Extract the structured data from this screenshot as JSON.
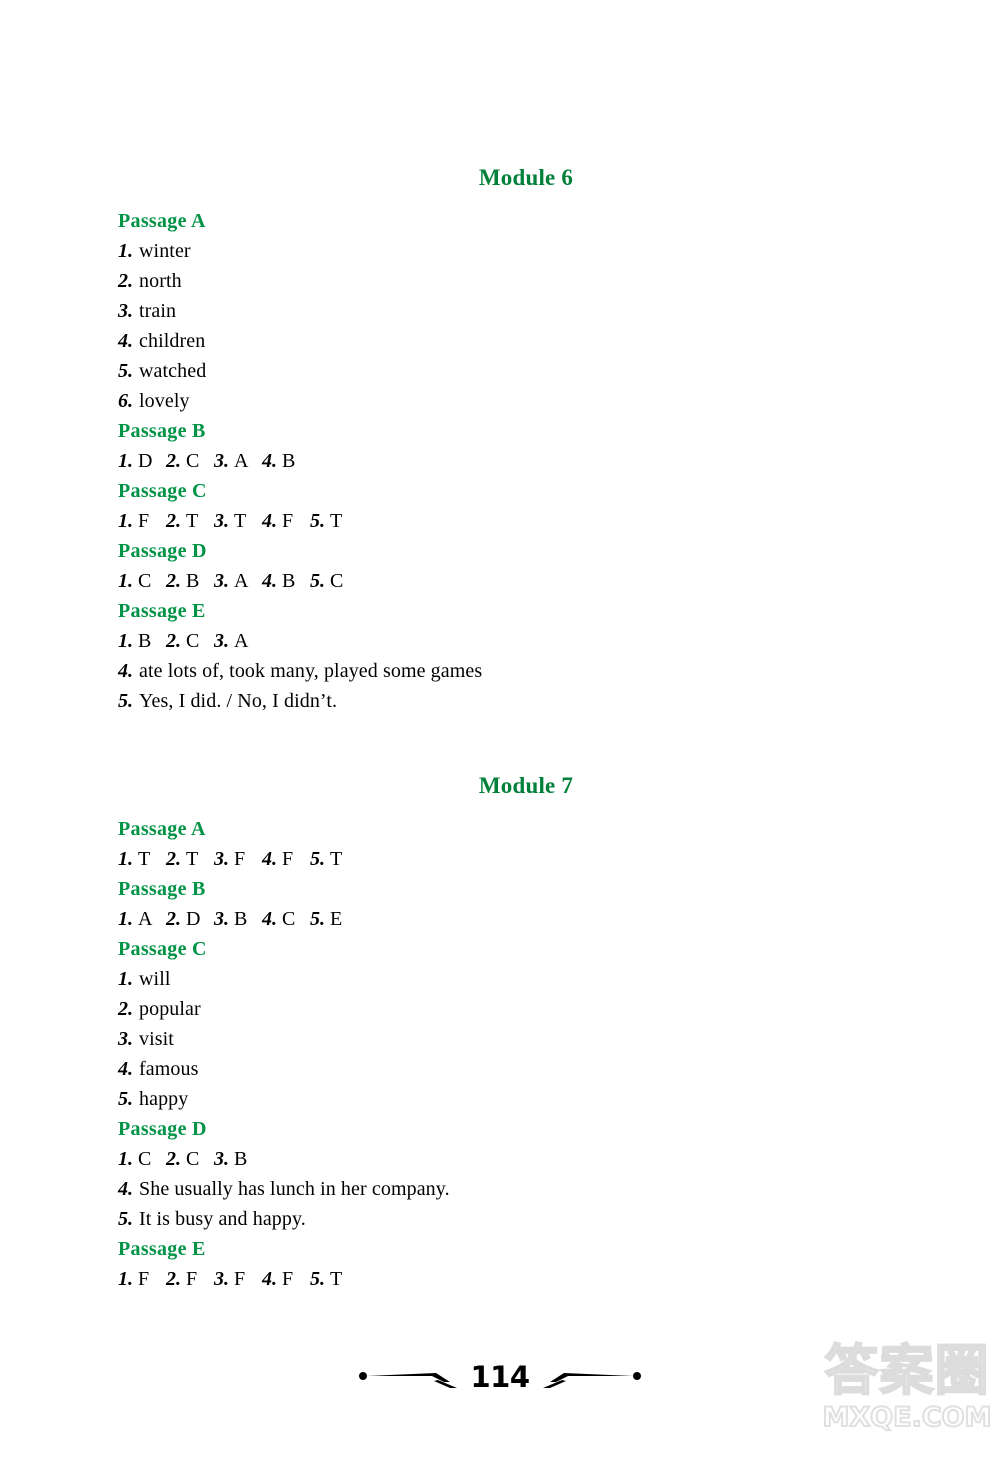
{
  "page": {
    "folio": "114",
    "watermark_cn": "答案圈",
    "watermark_url": "MXQE.COM",
    "accent_green": "#009245",
    "title_green": "#008038",
    "text_black": "#000000",
    "background": "#ffffff"
  },
  "modules": [
    {
      "title": "Module 6",
      "passages": [
        {
          "label": "Passage A",
          "layout": "stacked",
          "items": [
            {
              "num": "1.",
              "value": "winter"
            },
            {
              "num": "2.",
              "value": "north"
            },
            {
              "num": "3.",
              "value": "train"
            },
            {
              "num": "4.",
              "value": "children"
            },
            {
              "num": "5.",
              "value": "watched"
            },
            {
              "num": "6.",
              "value": "lovely"
            }
          ]
        },
        {
          "label": "Passage B",
          "layout": "inline",
          "items": [
            {
              "num": "1.",
              "value": "D"
            },
            {
              "num": "2.",
              "value": "C"
            },
            {
              "num": "3.",
              "value": "A"
            },
            {
              "num": "4.",
              "value": "B"
            }
          ]
        },
        {
          "label": "Passage C",
          "layout": "inline",
          "items": [
            {
              "num": "1.",
              "value": "F"
            },
            {
              "num": "2.",
              "value": "T"
            },
            {
              "num": "3.",
              "value": "T"
            },
            {
              "num": "4.",
              "value": "F"
            },
            {
              "num": "5.",
              "value": "T"
            }
          ]
        },
        {
          "label": "Passage D",
          "layout": "inline",
          "items": [
            {
              "num": "1.",
              "value": "C"
            },
            {
              "num": "2.",
              "value": "B"
            },
            {
              "num": "3.",
              "value": "A"
            },
            {
              "num": "4.",
              "value": "B"
            },
            {
              "num": "5.",
              "value": "C"
            }
          ]
        },
        {
          "label": "Passage E",
          "layout": "mixed",
          "inline_items": [
            {
              "num": "1.",
              "value": "B"
            },
            {
              "num": "2.",
              "value": "C"
            },
            {
              "num": "3.",
              "value": "A"
            }
          ],
          "items": [
            {
              "num": "4.",
              "value": "ate lots of, took many, played some games"
            },
            {
              "num": "5.",
              "value": "Yes, I did. / No, I didn’t."
            }
          ]
        }
      ]
    },
    {
      "title": "Module 7",
      "passages": [
        {
          "label": "Passage A",
          "layout": "inline",
          "items": [
            {
              "num": "1.",
              "value": "T"
            },
            {
              "num": "2.",
              "value": "T"
            },
            {
              "num": "3.",
              "value": "F"
            },
            {
              "num": "4.",
              "value": "F"
            },
            {
              "num": "5.",
              "value": "T"
            }
          ]
        },
        {
          "label": "Passage B",
          "layout": "inline",
          "items": [
            {
              "num": "1.",
              "value": "A"
            },
            {
              "num": "2.",
              "value": "D"
            },
            {
              "num": "3.",
              "value": "B"
            },
            {
              "num": "4.",
              "value": "C"
            },
            {
              "num": "5.",
              "value": "E"
            }
          ]
        },
        {
          "label": "Passage C",
          "layout": "stacked",
          "items": [
            {
              "num": "1.",
              "value": "will"
            },
            {
              "num": "2.",
              "value": "popular"
            },
            {
              "num": "3.",
              "value": "visit"
            },
            {
              "num": "4.",
              "value": "famous"
            },
            {
              "num": "5.",
              "value": "happy"
            }
          ]
        },
        {
          "label": "Passage D",
          "layout": "mixed",
          "inline_items": [
            {
              "num": "1.",
              "value": "C"
            },
            {
              "num": "2.",
              "value": "C"
            },
            {
              "num": "3.",
              "value": "B"
            }
          ],
          "items": [
            {
              "num": "4.",
              "value": "She usually has lunch in her company."
            },
            {
              "num": "5.",
              "value": "It is busy and happy."
            }
          ]
        },
        {
          "label": "Passage E",
          "layout": "inline",
          "items": [
            {
              "num": "1.",
              "value": "F"
            },
            {
              "num": "2.",
              "value": "F"
            },
            {
              "num": "3.",
              "value": "F"
            },
            {
              "num": "4.",
              "value": "F"
            },
            {
              "num": "5.",
              "value": "T"
            }
          ]
        }
      ]
    }
  ]
}
